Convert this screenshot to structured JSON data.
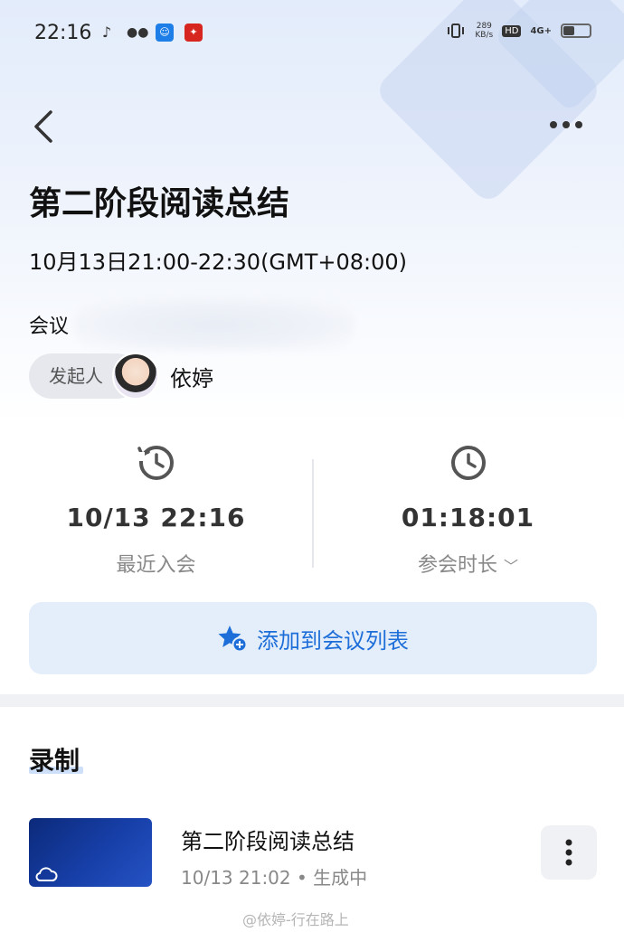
{
  "status_bar": {
    "time": "22:16",
    "net_speed_value": "289",
    "net_speed_unit": "KB/s",
    "hd": "HD",
    "signal": "4G+"
  },
  "header": {
    "title": "第二阶段阅读总结",
    "time_range": "10月13日21:00-22:30(GMT+08:00)",
    "meeting_id_prefix": "会议",
    "initiator_label": "发起人",
    "initiator_name": "依婷"
  },
  "stats": {
    "recent_join": {
      "value": "10/13 22:16",
      "label": "最近入会"
    },
    "duration": {
      "value": "01:18:01",
      "label": "参会时长"
    }
  },
  "add_button": {
    "label": "添加到会议列表"
  },
  "recordings": {
    "section_title": "录制",
    "items": [
      {
        "name": "第二阶段阅读总结",
        "date": "10/13 21:02",
        "status": "生成中"
      }
    ]
  },
  "watermark": "@依婷-行在路上",
  "colors": {
    "accent": "#1d6ed8",
    "icon_gray": "#555555"
  },
  "icons": [
    "music-note-icon",
    "wechat-icon",
    "app-icon",
    "red-app-icon",
    "vibrate-icon",
    "back-icon",
    "more-icon",
    "history-clock-icon",
    "clock-icon",
    "star-add-icon",
    "cloud-icon",
    "more-vertical-icon"
  ]
}
